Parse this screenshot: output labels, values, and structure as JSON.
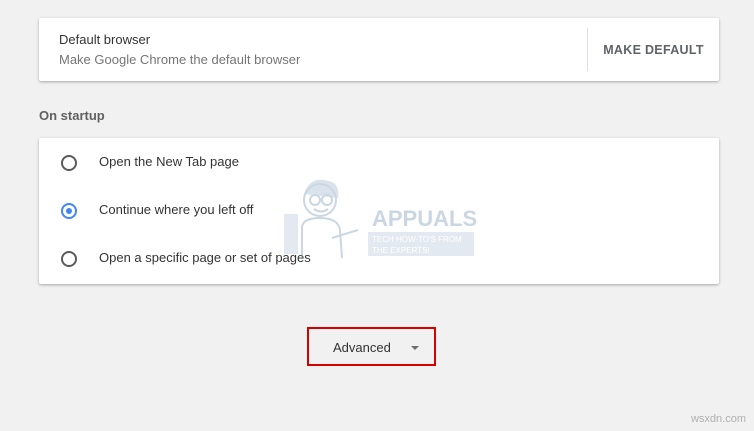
{
  "default_browser": {
    "title": "Default browser",
    "subtitle": "Make Google Chrome the default browser",
    "make_default_label": "MAKE DEFAULT"
  },
  "startup": {
    "section_title": "On startup",
    "options": [
      {
        "label": "Open the New Tab page",
        "selected": false
      },
      {
        "label": "Continue where you left off",
        "selected": true
      },
      {
        "label": "Open a specific page or set of pages",
        "selected": false
      }
    ]
  },
  "advanced": {
    "label": "Advanced",
    "icon": "caret-down-icon"
  },
  "watermark": {
    "brand": "APPUALS",
    "tagline_line1": "TECH HOW-TO'S FROM",
    "tagline_line2": "THE EXPERTS!"
  },
  "site_mark": "wsxdn.com",
  "colors": {
    "background": "#f1f1f1",
    "accent_blue": "#4285f4",
    "highlight_red": "#d50000"
  }
}
